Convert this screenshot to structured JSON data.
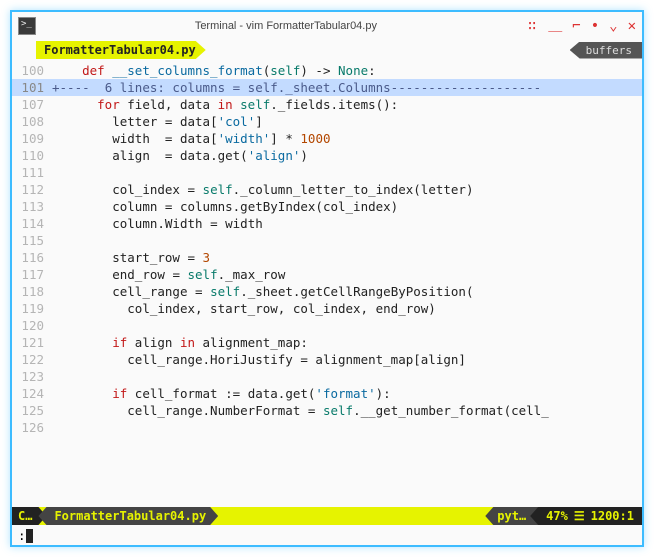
{
  "titlebar": {
    "title": "Terminal - vim FormatterTabular04.py"
  },
  "tab": {
    "label": "FormatterTabular04.py"
  },
  "buffers_label": "buffers",
  "gutter": {
    "l100": "100",
    "l101": "101",
    "l107": "107",
    "l108": "108",
    "l109": "109",
    "l110": "110",
    "l111": "111",
    "l112": "112",
    "l113": "113",
    "l114": "114",
    "l115": "115",
    "l116": "116",
    "l117": "117",
    "l118": "118",
    "l119": "119",
    "l120": "120",
    "l121": "121",
    "l122": "122",
    "l123": "123",
    "l124": "124",
    "l125": "125",
    "l126": "126"
  },
  "code": {
    "l100": {
      "indent": "    ",
      "def": "def ",
      "fn": "__set_columns_format",
      "sig": "(",
      "self": "self",
      "rest": ") -> ",
      "none": "None",
      "colon": ":"
    },
    "fold": {
      "marker": "+----  ",
      "text": "6 lines: columns = self._sheet.Columns",
      "dashes": "--------------------"
    },
    "l107": {
      "indent": "      ",
      "for": "for ",
      "v1": "field, data ",
      "in": "in ",
      "expr": "self",
      "dot": "._fields.items():"
    },
    "l108": {
      "indent": "        ",
      "lhs": "letter ",
      "eq": "= ",
      "rhs": "data[",
      "str": "'col'",
      "end": "]"
    },
    "l109": {
      "indent": "        ",
      "lhs": "width  ",
      "eq": "= ",
      "rhs": "data[",
      "str": "'width'",
      "mid": "] * ",
      "num": "1000"
    },
    "l110": {
      "indent": "        ",
      "lhs": "align  ",
      "eq": "= ",
      "rhs": "data.get(",
      "str": "'align'",
      "end": ")"
    },
    "l112": {
      "indent": "        ",
      "lhs": "col_index ",
      "eq": "= ",
      "self": "self",
      "rest": "._column_letter_to_index(letter)"
    },
    "l113": {
      "indent": "        ",
      "lhs": "column ",
      "eq": "= ",
      "rhs": "columns.getByIndex(col_index)"
    },
    "l114": {
      "indent": "        ",
      "lhs": "column.Width ",
      "eq": "= ",
      "rhs": "width"
    },
    "l116": {
      "indent": "        ",
      "lhs": "start_row ",
      "eq": "= ",
      "num": "3"
    },
    "l117": {
      "indent": "        ",
      "lhs": "end_row ",
      "eq": "= ",
      "self": "self",
      "rest": "._max_row"
    },
    "l118": {
      "indent": "        ",
      "lhs": "cell_range ",
      "eq": "= ",
      "self": "self",
      "rest": "._sheet.getCellRangeByPosition("
    },
    "l119": {
      "indent": "          ",
      "rhs": "col_index, start_row, col_index, end_row)"
    },
    "l121": {
      "indent": "        ",
      "if": "if ",
      "v": "align ",
      "in": "in ",
      "rhs": "alignment_map:"
    },
    "l122": {
      "indent": "          ",
      "lhs": "cell_range.HoriJustify ",
      "eq": "= ",
      "rhs": "alignment_map[align]"
    },
    "l124": {
      "indent": "        ",
      "if": "if ",
      "lhs": "cell_format ",
      "walrus": ":= ",
      "rhs": "data.get(",
      "str": "'format'",
      "end": "):"
    },
    "l125": {
      "indent": "          ",
      "lhs": "cell_range.NumberFormat ",
      "eq": "= ",
      "self": "self",
      "rest": ".__get_number_format(cell_"
    }
  },
  "status": {
    "mode": "C…",
    "file": "FormatterTabular04.py",
    "ft": "pyt…",
    "pct": "47%",
    "sep": "☰",
    "line": "1200",
    "col": "1"
  },
  "cmd": {
    "prompt": ":"
  }
}
